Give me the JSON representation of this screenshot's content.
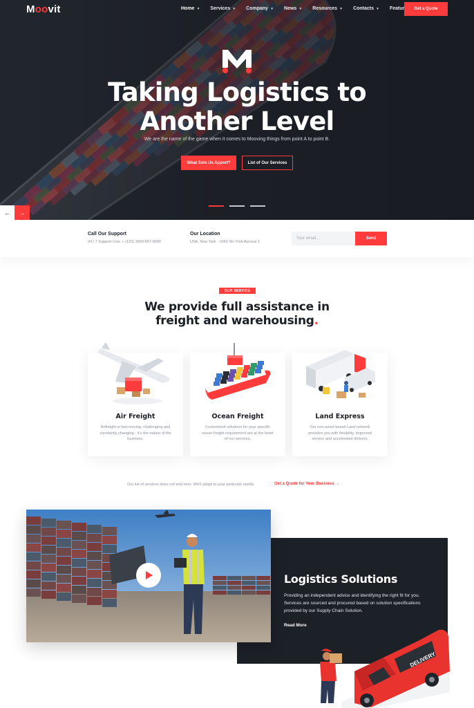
{
  "brand": {
    "logo_pre": "M",
    "logo_oo": "oo",
    "logo_post": "vit"
  },
  "nav": {
    "items": [
      {
        "label": "Home"
      },
      {
        "label": "Services"
      },
      {
        "label": "Company"
      },
      {
        "label": "News"
      },
      {
        "label": "Resources"
      },
      {
        "label": "Contacts"
      },
      {
        "label": "Features"
      }
    ],
    "cta": "Get a Quote"
  },
  "hero": {
    "title_line1": "Taking Logistics to",
    "title_line2": "Another Level",
    "subtitle": "We are the name of the game when it comes to Mooving things from point A to point B.",
    "btn_primary": "What Sets Us Apport?",
    "btn_secondary": "List of Our Services",
    "prev_arrow": "←",
    "next_arrow": "→"
  },
  "info": {
    "support_title": "Call Our Support",
    "support_text": "24 / 7 Support Line: + (123) 1800-567-8990",
    "location_title": "Our Location",
    "location_text": "USA, New York - 1060 Str. First Avenue 1",
    "email_placeholder": "Your email...",
    "send": "Send"
  },
  "services": {
    "badge": "OUR SERVICE",
    "heading_line1": "We provide full assistance in",
    "heading_line2": "freight and warehousing",
    "heading_dot": ".",
    "cards": [
      {
        "title": "Air Freight",
        "text": "Airfreight is fast-moving, challenging and constantly changing - it's the nature of the business."
      },
      {
        "title": "Ocean Freight",
        "text": "Customized solutions for your specific ocean freight requirement are at the heart of our services."
      },
      {
        "title": "Land Express",
        "text": "Our non-asset based Land network provides you with flexibility, improved service and accelerated delivery."
      }
    ],
    "more_text": "Our list of services does not end here. We'll adapt to your particular needs.",
    "more_link": "Get a Quote for Your Business →"
  },
  "logistics": {
    "title": "Logistics Solutions",
    "text": "Providing an independent advice and identifying the right fit for you. Services are sourced and procured based on solution specifications provided by our Supply Chain Solution.",
    "read_more": "Read More",
    "van_label": "DELIVERY"
  },
  "colors": {
    "accent": "#ff3b3b",
    "dark": "#1c2027"
  }
}
